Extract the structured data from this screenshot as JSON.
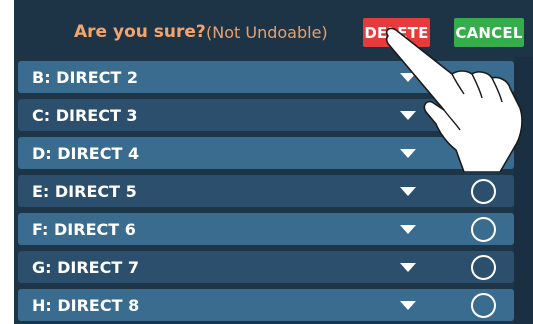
{
  "header": {
    "confirm_text": "Are you sure?",
    "note_text": "(Not Undoable)",
    "delete_label": "DELETE",
    "cancel_label": "CANCEL",
    "colors": {
      "delete": "#e73a3a",
      "cancel": "#35ad4a",
      "confirm_text": "#f3a56b"
    }
  },
  "list": {
    "items": [
      {
        "label": "B: DIRECT 2",
        "icons": [
          "dropdown-caret-icon"
        ]
      },
      {
        "label": "C: DIRECT 3",
        "icons": [
          "dropdown-caret-icon"
        ]
      },
      {
        "label": "D: DIRECT 4",
        "icons": [
          "dropdown-caret-icon"
        ]
      },
      {
        "label": "E: DIRECT 5",
        "icons": [
          "dropdown-caret-icon",
          "radio-circle-icon"
        ]
      },
      {
        "label": "F: DIRECT 6",
        "icons": [
          "dropdown-caret-icon",
          "radio-circle-icon"
        ]
      },
      {
        "label": "G: DIRECT 7",
        "icons": [
          "dropdown-caret-icon",
          "radio-circle-icon"
        ]
      },
      {
        "label": "H: DIRECT 8",
        "icons": [
          "dropdown-caret-icon",
          "radio-circle-icon"
        ]
      }
    ]
  },
  "overlay": {
    "icon": "pointing-hand-icon"
  }
}
